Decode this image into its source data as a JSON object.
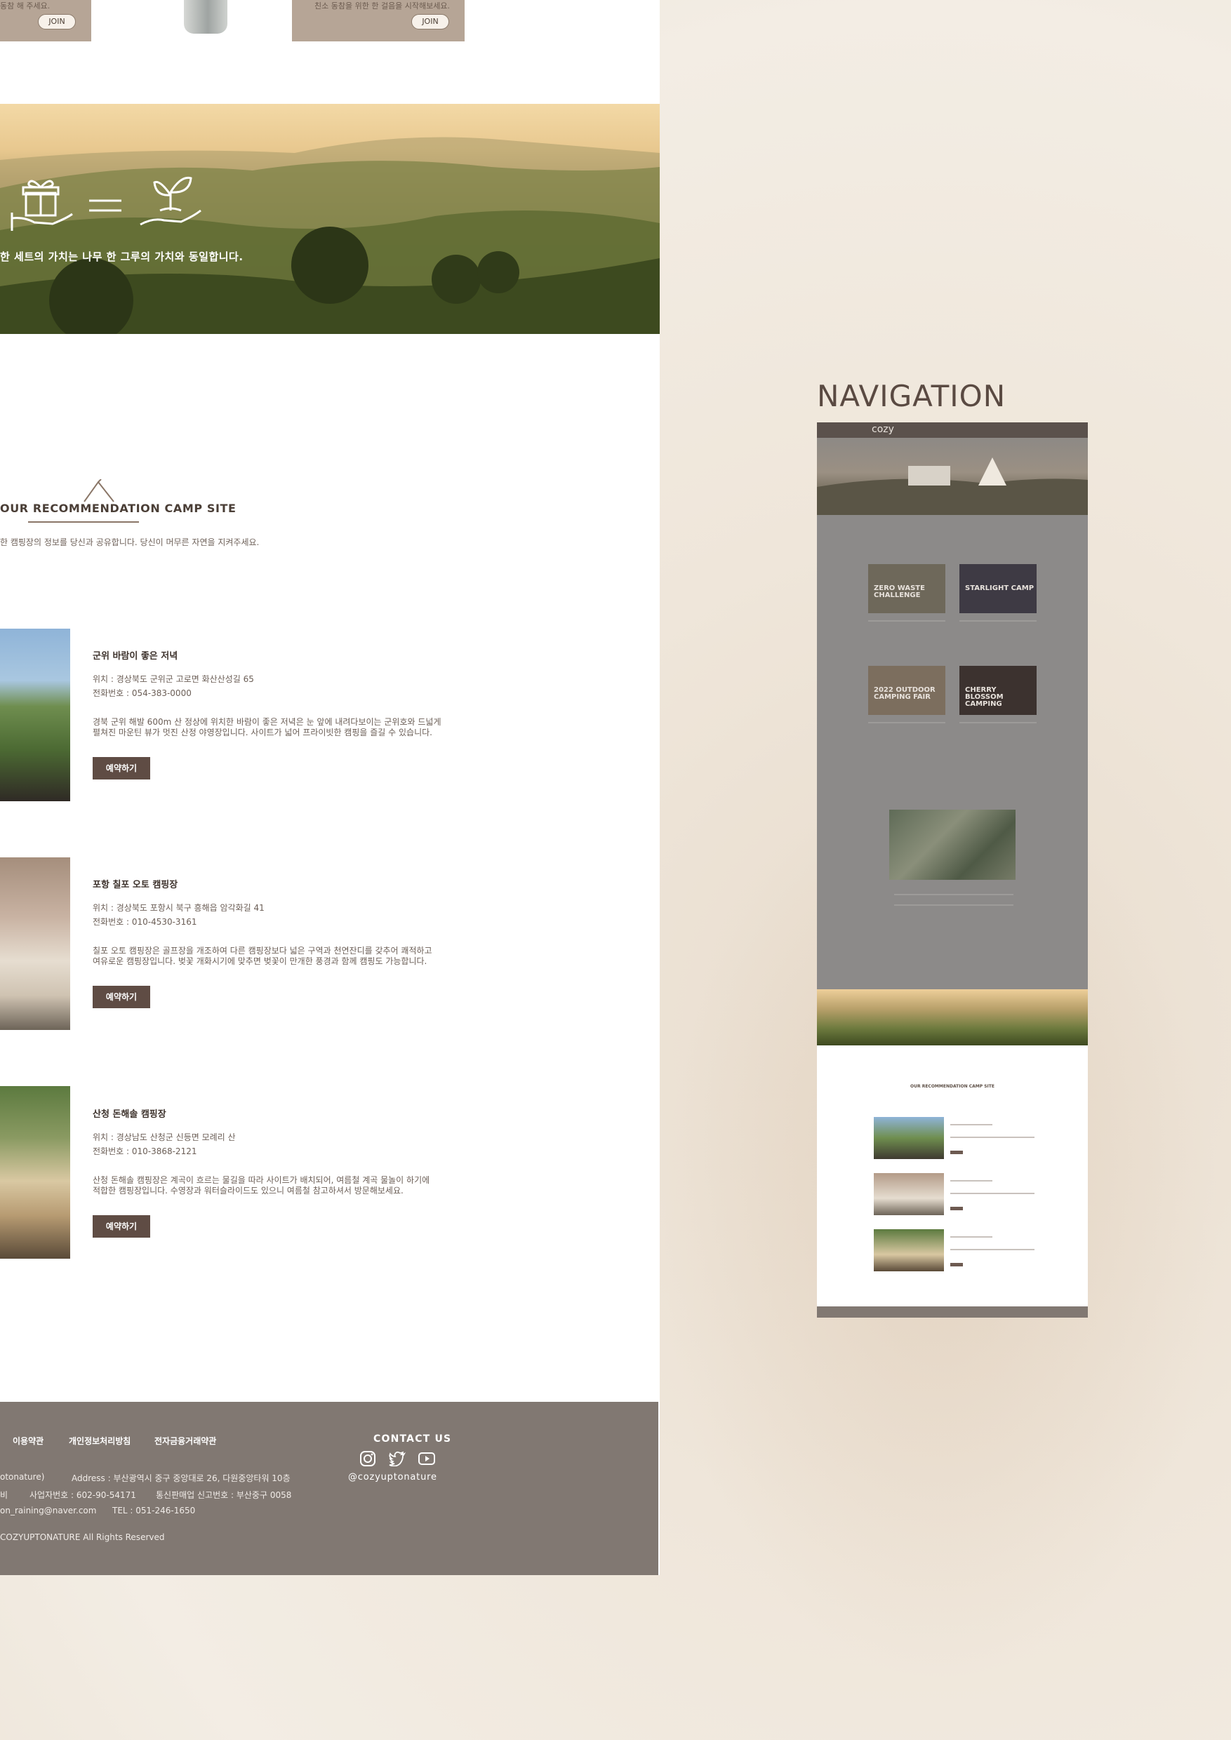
{
  "top_cards": {
    "left_text": "동참 해 주세요.",
    "right_text": "친소 동참을 위한 한 걸음을 시작해보세요.",
    "join_label": "JOIN"
  },
  "hero": {
    "caption": "한 세트의 가치는 나무 한 그루의 가치와 동일합니다."
  },
  "camp_section": {
    "title": "OUR RECOMMENDATION CAMP SITE",
    "subtitle": "한 캠핑장의 정보를 당신과 공유합니다. 당신이 머무른 자연을 지켜주세요.",
    "sites": [
      {
        "name": "군위 바람이 좋은 저녁",
        "location": "위치 : 경상북도 군위군 고로면 화산산성길 65",
        "phone": "전화번호 : 054-383-0000",
        "desc_line1": "경북 군위 해발 600m 산 정상에 위치한 바람이 좋은 저녁은 눈 앞에 내려다보이는 군위호와 드넓게",
        "desc_line2": "펼쳐진 마운틴 뷰가 멋진 산정 야영장입니다. 사이트가 넓어 프라이빗한 캠핑을 즐길 수 있습니다.",
        "button": "예약하기"
      },
      {
        "name": "포항 칠포 오토 캠핑장",
        "location": "위치 : 경상북도 포항시 북구 흥해읍 암각화길 41",
        "phone": "전화번호 : 010-4530-3161",
        "desc_line1": "칠포 오토 캠핑장은 골프장을 개조하여 다른 캠핑장보다 넓은 구역과 천연잔디를 갖추어 쾌적하고",
        "desc_line2": "여유로운 캠핑장입니다. 벚꽃 개화시기에 맞추면 벚꽃이 만개한 풍경과 함께 캠핑도 가능합니다.",
        "button": "예약하기"
      },
      {
        "name": "산청 돈해솔 캠핑장",
        "location": "위치 : 경상남도 산청군 신등면 모례리 산",
        "phone": "전화번호 : 010-3868-2121",
        "desc_line1": "산청 돈해솔 캠핑장은 계곡이 흐르는 물길을 따라 사이트가 배치되어, 여름철 계곡 물놀이 하기에",
        "desc_line2": "적합한 캠핑장입니다. 수영장과 워터슬라이드도 있으니 여름철 참고하셔서 방문해보세요.",
        "button": "예약하기"
      }
    ]
  },
  "footer": {
    "links": [
      "이용약관",
      "개인정보처리방침",
      "전자금융거래약관"
    ],
    "address_row1_left": "otonature)",
    "address_row1_right": "Address : 부산광역시 중구 중앙대로 26, 다원중앙타워 10층",
    "address_row2_left": "비",
    "address_row2_mid": "사업자번호 : 602-90-54171",
    "address_row2_right": "통신판매업 신고번호 : 부산중구 0058",
    "address_row3_left": "on_raining@naver.com",
    "address_row3_right": "TEL : 051-246-1650",
    "copyright": "COZYUPTONATURE All Rights Reserved",
    "contact_title": "CONTACT US",
    "handle": "@cozyuptonature"
  },
  "navigation": {
    "title": "NAVIGATION",
    "thumb_logo": "cozy",
    "thumb_cards": [
      "ZERO WASTE CHALLENGE",
      "STARLIGHT CAMP",
      "2022 OUTDOOR CAMPING FAIR",
      "CHERRY BLOSSOM CAMPING"
    ],
    "thumb_camp_title": "OUR RECOMMENDATION CAMP SITE"
  },
  "colors": {
    "brand_brown": "#5f4c44",
    "footer_gray": "#817872",
    "card_tan": "#b6a596"
  }
}
